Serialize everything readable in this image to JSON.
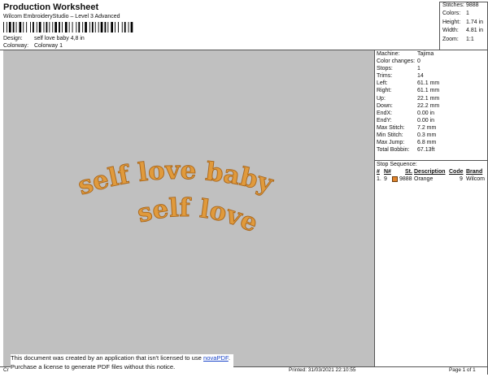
{
  "header": {
    "title": "Production Worksheet",
    "subtitle": "Wilcom EmbroideryStudio – Level 3 Advanced",
    "design_label": "Design:",
    "design_value": "self love baby 4,8 in",
    "colorway_label": "Colorway:",
    "colorway_value": "Colorway 1"
  },
  "stats": [
    {
      "label": "Stitches:",
      "value": "9888"
    },
    {
      "label": "Colors:",
      "value": "1"
    },
    {
      "label": "Height:",
      "value": "1.74 in"
    },
    {
      "label": "Width:",
      "value": "4.81 in"
    },
    {
      "label": "Zoom:",
      "value": "1:1"
    }
  ],
  "design": {
    "line1": "self love baby",
    "line2": "self love",
    "thread_color": "#e09a3c",
    "background_color": "#c0c0c0"
  },
  "machine_info": [
    {
      "label": "Machine:",
      "value": "Tajima"
    },
    {
      "label": "Color changes:",
      "value": "0"
    },
    {
      "label": "Stops:",
      "value": "1"
    },
    {
      "label": "Trims:",
      "value": "14"
    },
    {
      "label": "Left:",
      "value": "61.1 mm"
    },
    {
      "label": "Right:",
      "value": "61.1 mm"
    },
    {
      "label": "Up:",
      "value": "22.1 mm"
    },
    {
      "label": "Down:",
      "value": "22.2 mm"
    },
    {
      "label": "EndX:",
      "value": "0.00 in"
    },
    {
      "label": "EndY:",
      "value": "0.00 in"
    },
    {
      "label": "Max Stitch:",
      "value": "7.2 mm"
    },
    {
      "label": "Min Stitch:",
      "value": "0.3 mm"
    },
    {
      "label": "Max Jump:",
      "value": "6.8 mm"
    },
    {
      "label": "Total Bobbin:",
      "value": "67.13ft"
    }
  ],
  "stop_sequence": {
    "title": "Stop Sequence:",
    "columns": [
      "#",
      "N#",
      "St.",
      "Description",
      "Code",
      "Brand"
    ],
    "rows": [
      {
        "index": "1.",
        "n": "9",
        "color": "#e0832a",
        "stitches": "9888",
        "description": "Orange",
        "code": "9",
        "brand": "Wilcom"
      }
    ]
  },
  "notice": {
    "line1_prefix": "This document was created by an application that isn't licensed to use ",
    "link_text": "novaPDF",
    "line1_suffix": ".",
    "line2": "Purchase a license to generate PDF files without this notice."
  },
  "footer": {
    "left": "Cr",
    "printed": "Printed: 31/03/2021 22:10:55",
    "page": "Page 1 of 1"
  }
}
